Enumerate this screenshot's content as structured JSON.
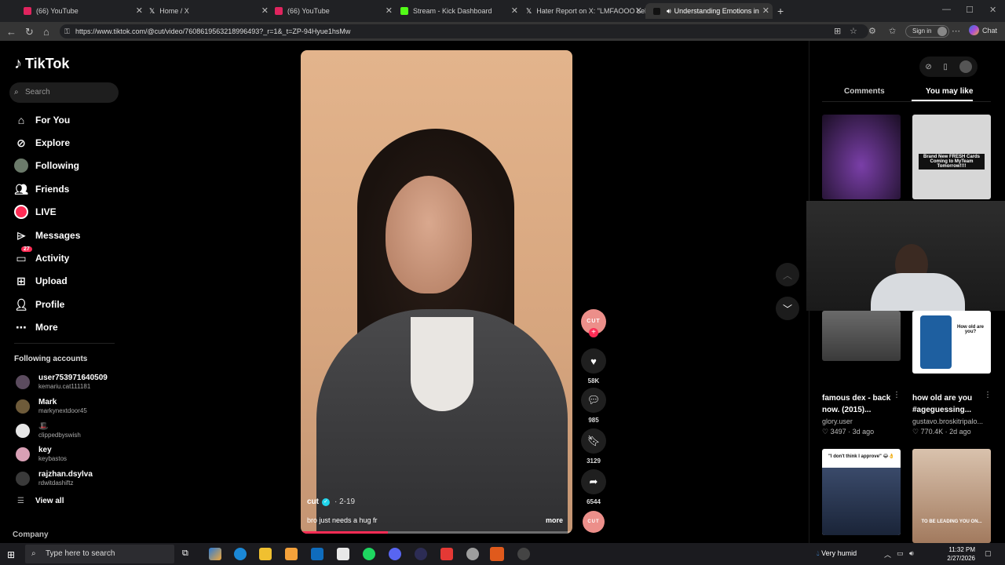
{
  "browser": {
    "tabs": [
      {
        "label": "(66) YouTube",
        "color": "#e0245e",
        "active": false
      },
      {
        "label": "Home / X",
        "color": "#ffffff",
        "active": false
      },
      {
        "label": "(66) YouTube",
        "color": "#e0245e",
        "active": false
      },
      {
        "label": "Stream - Kick Dashboard",
        "color": "#53fc18",
        "active": false
      },
      {
        "label": "Hater Report on X: \"LMFAOOO Lel",
        "color": "#ffffff",
        "active": false
      },
      {
        "label": "Understanding Emotions in R",
        "color": "#ffffff",
        "active": true
      }
    ],
    "url": "https://www.tiktok.com/@cut/video/7608619563218996493?_r=1&_t=ZP-94Hyue1hsMw",
    "signin": "Sign in",
    "chat": "Chat"
  },
  "tiktok": {
    "logo": "TikTok",
    "search_placeholder": "Search",
    "nav": [
      {
        "label": "For You",
        "icon": "home-icon"
      },
      {
        "label": "Explore",
        "icon": "compass-icon"
      },
      {
        "label": "Following",
        "icon": "following-avatar-icon"
      },
      {
        "label": "Friends",
        "icon": "friends-icon"
      },
      {
        "label": "LIVE",
        "icon": "live-icon"
      },
      {
        "label": "Messages",
        "icon": "messages-icon"
      },
      {
        "label": "Activity",
        "icon": "activity-icon",
        "badge": "27"
      },
      {
        "label": "Upload",
        "icon": "upload-icon"
      },
      {
        "label": "Profile",
        "icon": "profile-icon"
      },
      {
        "label": "More",
        "icon": "more-icon"
      }
    ],
    "following_title": "Following accounts",
    "accounts": [
      {
        "name": "user7539716405​09",
        "handle": "kemariu.cat111181",
        "color": "#5b4b5e"
      },
      {
        "name": "Mark",
        "handle": "markynextdoor45",
        "color": "#6e5b3a"
      },
      {
        "name": "🎩",
        "handle": "clippedbyswish",
        "color": "#e6e6e6"
      },
      {
        "name": "key",
        "handle": "keybastos",
        "color": "#d9a0b5"
      },
      {
        "name": "rajzhan.dsylva",
        "handle": "rdwitdashiftz",
        "color": "#3a3a3a"
      }
    ],
    "view_all": "View all",
    "company": "Company"
  },
  "video": {
    "author": "cut",
    "date": "· 2-19",
    "caption": "bro just needs a hug fr",
    "more": "more",
    "progress": 0.32
  },
  "actions": {
    "creator_label": "CUT",
    "likes": "58K",
    "comments": "985",
    "saves": "3129",
    "shares": "6544"
  },
  "right_panel": {
    "tabs": [
      "Comments",
      "You may like"
    ],
    "active_tab": "You may like",
    "items": [
      {
        "caption": "",
        "user": "",
        "meta": "",
        "thumb_color": "#3b1f4d"
      },
      {
        "caption": "",
        "user": "",
        "meta": "",
        "thumb_color": "#d7d7d7",
        "overlay": "Brand New FRESH Cards Coming to MyTeam Tomorrow!!!!"
      },
      {
        "caption": "famous dex - back now. (2015)...",
        "user": "glory.user",
        "likes": "3497",
        "age": "3d ago",
        "thumb_color": "#5a5a5a"
      },
      {
        "caption": "how old are you #ageguessing...",
        "user": "gustavo.broskitripalo...",
        "likes": "770.4K",
        "age": "2d ago",
        "thumb_color": "#1e5fa0",
        "overlay": "How old are you?"
      },
      {
        "caption": "",
        "user": "",
        "meta": "",
        "thumb_color": "#2c3a55",
        "overlay": "\"I don't think I approve\" 😂👌"
      },
      {
        "caption": "",
        "user": "",
        "meta": "",
        "thumb_color": "#c89b7b",
        "overlay": "TO BE LEADING YOU ON..."
      }
    ]
  },
  "taskbar": {
    "search_placeholder": "Type here to search",
    "weather": "Very humid",
    "time": "11:32 PM",
    "date": "2/27/2026"
  }
}
